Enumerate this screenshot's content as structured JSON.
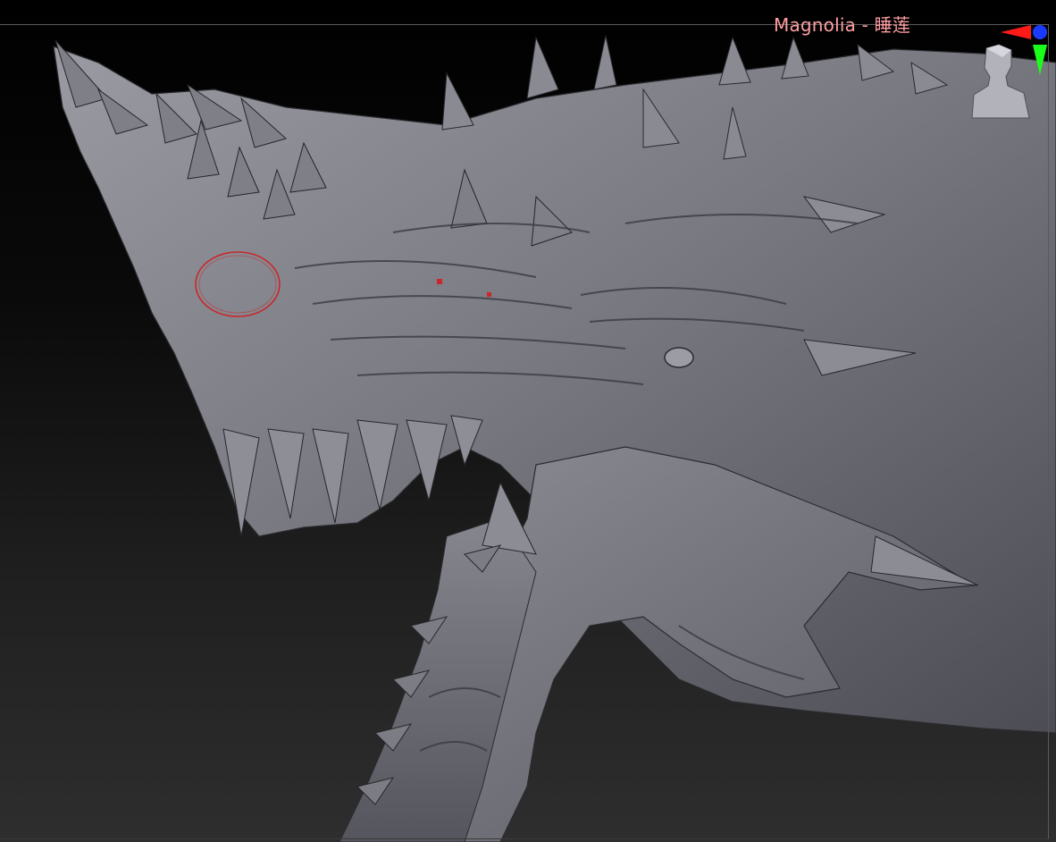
{
  "app": {
    "document_title": "Magnolia - 睡莲"
  },
  "viewport": {
    "model_name_icon": "dragon-head-sculpt",
    "background_gradient": [
      "#000000",
      "#2e2e2e"
    ],
    "title_color": "#ff9fa3"
  },
  "navigator": {
    "gizmo_icon": "axis-gizmo-icon",
    "head_icon": "orientation-head-icon",
    "axis_colors": {
      "x": "#ff1a1a",
      "y": "#1aff1a",
      "z": "#1a3aff"
    }
  },
  "brush": {
    "icon": "brush-cursor-icon",
    "color": "#c8282a"
  }
}
